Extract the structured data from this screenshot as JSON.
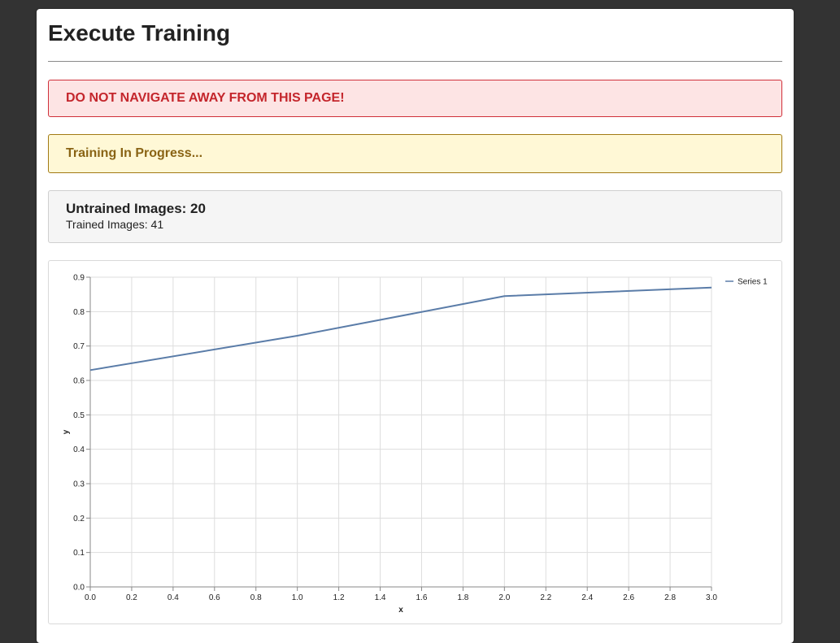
{
  "page": {
    "title": "Execute Training"
  },
  "alerts": {
    "danger_text": "DO NOT NAVIGATE AWAY FROM THIS PAGE!",
    "warning_text": "Training In Progress..."
  },
  "stats": {
    "untrained_label": "Untrained Images: 20",
    "trained_label": "Trained Images: 41",
    "untrained_count": 20,
    "trained_count": 41
  },
  "colors": {
    "series": "#5a7ca8",
    "background": "#333333",
    "danger": "#c4262c",
    "warning": "#8a6415"
  },
  "chart_data": {
    "type": "line",
    "xlabel": "x",
    "ylabel": "y",
    "xlim": [
      0,
      3
    ],
    "ylim": [
      0,
      0.9
    ],
    "xticks": [
      "0.0",
      "0.2",
      "0.4",
      "0.6",
      "0.8",
      "1.0",
      "1.2",
      "1.4",
      "1.6",
      "1.8",
      "2.0",
      "2.2",
      "2.4",
      "2.6",
      "2.8",
      "3.0"
    ],
    "yticks": [
      "0.0",
      "0.1",
      "0.2",
      "0.3",
      "0.4",
      "0.5",
      "0.6",
      "0.7",
      "0.8",
      "0.9"
    ],
    "grid": true,
    "legend_position": "top-right",
    "series": [
      {
        "name": "Series 1",
        "x": [
          0,
          1,
          2,
          3
        ],
        "values": [
          0.63,
          0.73,
          0.845,
          0.87
        ]
      }
    ]
  }
}
